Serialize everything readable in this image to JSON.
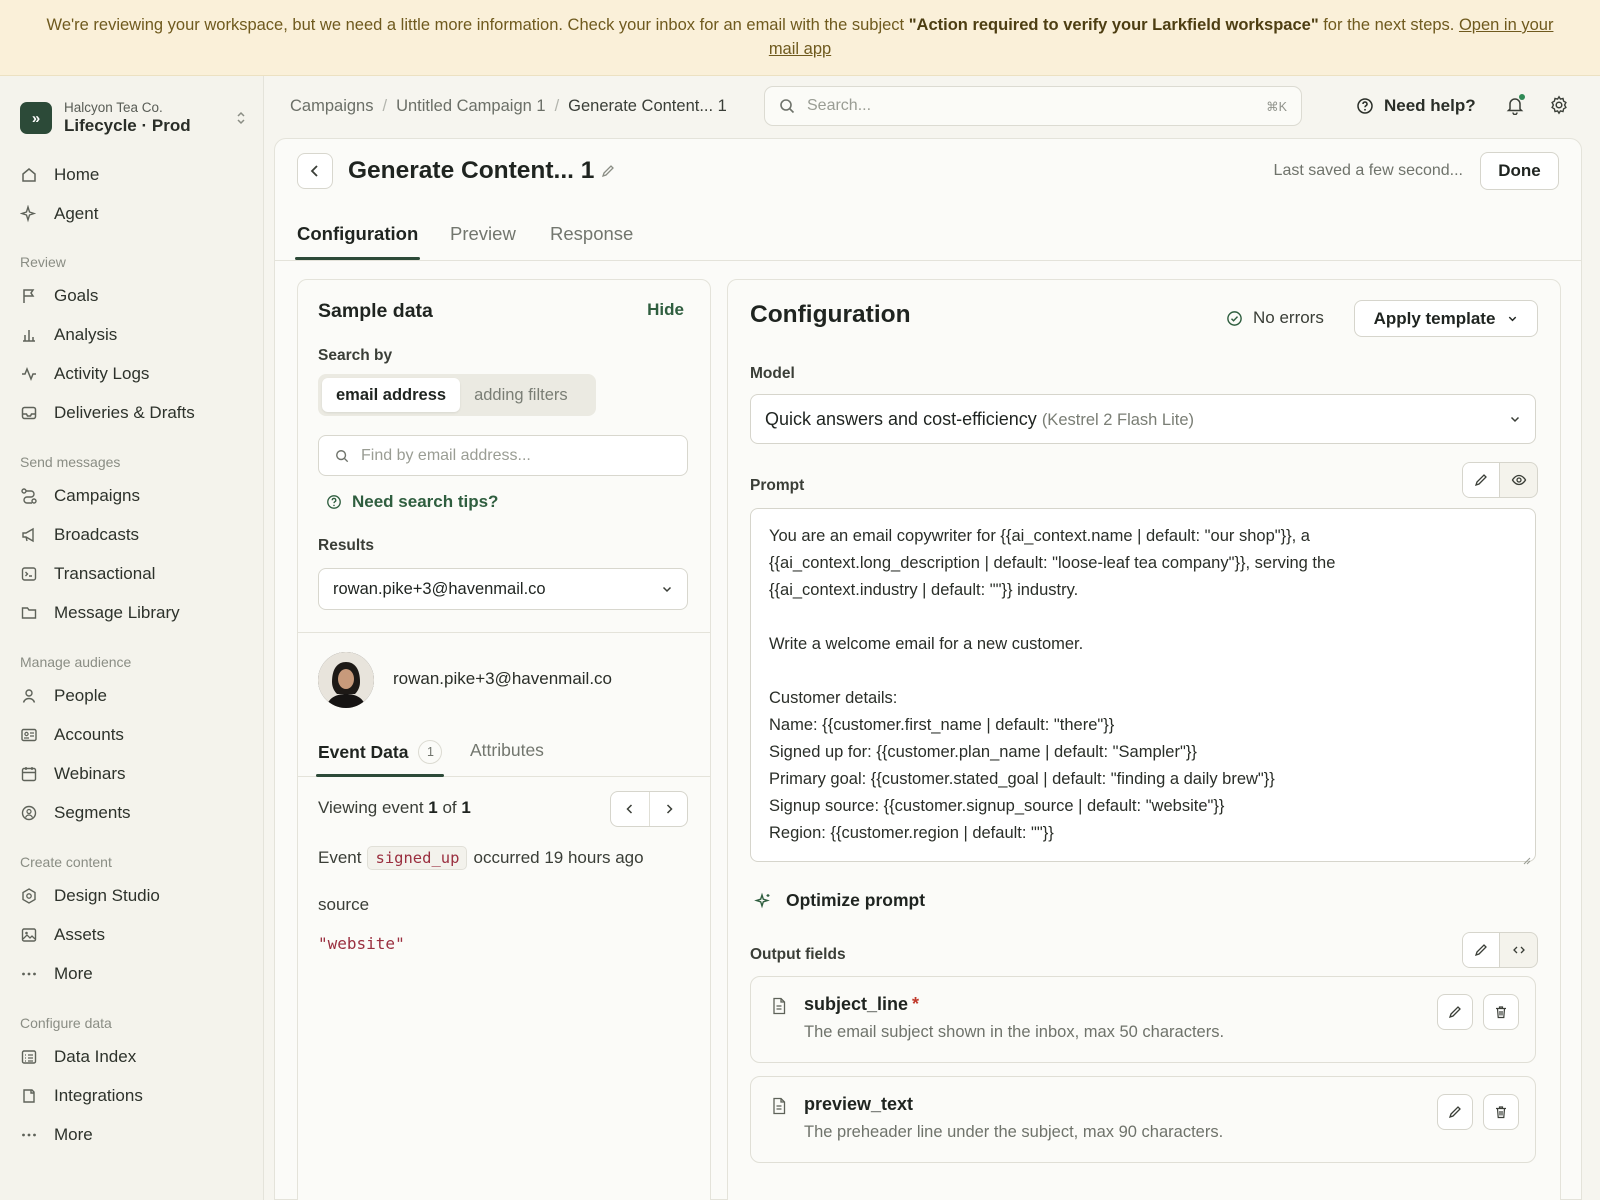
{
  "banner": {
    "text_before": "We're reviewing your workspace, but we need a little more information. Check your inbox for an email with the subject ",
    "subject": "\"Action required to verify your Larkfield workspace\"",
    "text_after": " for the next steps. ",
    "link": "Open in your mail app"
  },
  "workspace": {
    "org": "Halcyon Tea Co.",
    "name": "Lifecycle · Prod",
    "logo_glyph": "»"
  },
  "sidebar": {
    "top_items": [
      {
        "label": "Home",
        "icon": "home-icon"
      },
      {
        "label": "Agent",
        "icon": "sparkle-icon"
      }
    ],
    "sections": [
      {
        "title": "Review",
        "items": [
          {
            "label": "Goals",
            "icon": "flag-icon"
          },
          {
            "label": "Analysis",
            "icon": "bar-chart-icon"
          },
          {
            "label": "Activity Logs",
            "icon": "activity-icon"
          },
          {
            "label": "Deliveries & Drafts",
            "icon": "inbox-icon"
          }
        ]
      },
      {
        "title": "Send messages",
        "items": [
          {
            "label": "Campaigns",
            "icon": "route-icon"
          },
          {
            "label": "Broadcasts",
            "icon": "megaphone-icon"
          },
          {
            "label": "Transactional",
            "icon": "terminal-icon"
          },
          {
            "label": "Message Library",
            "icon": "folder-icon"
          }
        ]
      },
      {
        "title": "Manage audience",
        "items": [
          {
            "label": "People",
            "icon": "person-icon"
          },
          {
            "label": "Accounts",
            "icon": "id-card-icon"
          },
          {
            "label": "Webinars",
            "icon": "calendar-icon"
          },
          {
            "label": "Segments",
            "icon": "segment-icon"
          }
        ]
      },
      {
        "title": "Create content",
        "items": [
          {
            "label": "Design Studio",
            "icon": "hexagon-icon"
          },
          {
            "label": "Assets",
            "icon": "image-icon"
          },
          {
            "label": "More",
            "icon": "more-icon"
          }
        ]
      },
      {
        "title": "Configure data",
        "items": [
          {
            "label": "Data Index",
            "icon": "list-icon"
          },
          {
            "label": "Integrations",
            "icon": "plug-icon"
          },
          {
            "label": "More",
            "icon": "more-icon"
          }
        ]
      }
    ]
  },
  "breadcrumb": [
    "Campaigns",
    "Untitled Campaign 1",
    "Generate Content... 1"
  ],
  "search": {
    "placeholder": "Search...",
    "shortcut": "⌘K"
  },
  "header": {
    "help": "Need help?"
  },
  "page": {
    "title": "Generate Content... 1",
    "saved": "Last saved a few second...",
    "done": "Done",
    "tabs": [
      "Configuration",
      "Preview",
      "Response"
    ],
    "active_tab": "Configuration"
  },
  "sample": {
    "title": "Sample data",
    "hide": "Hide",
    "search_by_label": "Search by",
    "search_by_options": [
      "email address",
      "adding filters"
    ],
    "search_by_selected": "email address",
    "find_placeholder": "Find by email address...",
    "tips": "Need search tips?",
    "results_label": "Results",
    "results_value": "rowan.pike+3@havenmail.co",
    "person_email": "rowan.pike+3@havenmail.co",
    "subtabs": [
      {
        "label": "Event Data",
        "count": "1"
      },
      {
        "label": "Attributes"
      }
    ],
    "viewing_prefix": "Viewing event ",
    "viewing_current": "1",
    "viewing_of": " of ",
    "viewing_total": "1",
    "event_prefix": "Event",
    "event_name": "signed_up",
    "event_suffix": "occurred 19 hours ago",
    "attr_key": "source",
    "attr_value": "\"website\""
  },
  "config": {
    "title": "Configuration",
    "status": "No errors",
    "apply": "Apply template",
    "model_label": "Model",
    "model_value": "Quick answers and cost-efficiency",
    "model_sub": "(Kestrel 2 Flash Lite)",
    "prompt_label": "Prompt",
    "prompt_lines": [
      "You are an email copywriter for {{ai_context.name | default: \"our shop\"}}, a",
      "{{ai_context.long_description | default: \"loose-leaf tea company\"}}, serving the",
      "{{ai_context.industry | default: \"\"}} industry.",
      "",
      "Write a welcome email for a new customer.",
      "",
      "Customer details:",
      "Name: {{customer.first_name | default: \"there\"}}",
      "Signed up for: {{customer.plan_name | default: \"Sampler\"}}",
      "Primary goal: {{customer.stated_goal | default: \"finding a daily brew\"}}",
      "Signup source: {{customer.signup_source | default: \"website\"}}",
      "Region: {{customer.region | default: \"\"}}"
    ],
    "optimize": "Optimize prompt",
    "output_label": "Output fields",
    "fields": [
      {
        "name": "subject_line",
        "required": "*",
        "desc": "The email subject shown in the inbox, max 50 characters."
      },
      {
        "name": "preview_text",
        "required": "",
        "desc": "The preheader line under the subject, max 90 characters."
      }
    ]
  },
  "colors": {
    "brand": "#2c4a38",
    "link": "#2f5e3f",
    "banner_bg": "#faf0d9",
    "code": "#9a2f3f",
    "required": "#c0392b"
  }
}
